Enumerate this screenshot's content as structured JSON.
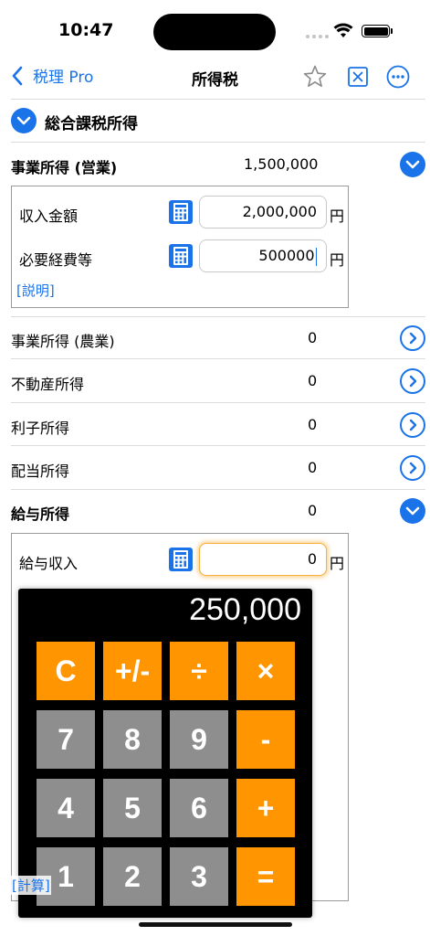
{
  "status_bar": {
    "time": "10:47"
  },
  "nav": {
    "back_label": "税理 Pro",
    "title": "所得税",
    "icons": [
      "star-icon",
      "close-square-icon",
      "more-icon"
    ]
  },
  "sections": {
    "general": "総合課税所得",
    "business": {
      "label": "事業所得 (営業)",
      "value": "1,500,000"
    },
    "business_detail": {
      "revenue_label": "収入金額",
      "revenue_value": "2,000,000",
      "expenses_label": "必要経費等",
      "expenses_value": "500000",
      "unit": "円",
      "explain_link": "[説明]"
    },
    "rows": [
      {
        "label": "事業所得 (農業)",
        "value": "0"
      },
      {
        "label": "不動産所得",
        "value": "0"
      },
      {
        "label": "利子所得",
        "value": "0"
      },
      {
        "label": "配当所得",
        "value": "0"
      }
    ],
    "salary": {
      "label": "給与所得",
      "value": "0"
    },
    "salary_detail": {
      "income_label": "給与収入",
      "income_value": "0",
      "unit": "円",
      "calc_link": "[計算]"
    }
  },
  "calculator": {
    "display": "250,000",
    "keys": [
      "C",
      "+/-",
      "÷",
      "×",
      "7",
      "8",
      "9",
      "-",
      "4",
      "5",
      "6",
      "+",
      "1",
      "2",
      "3",
      "="
    ]
  },
  "colors": {
    "accent": "#1a73e8",
    "calc_orange": "#ff9500",
    "calc_gray": "#8e8e8e"
  }
}
